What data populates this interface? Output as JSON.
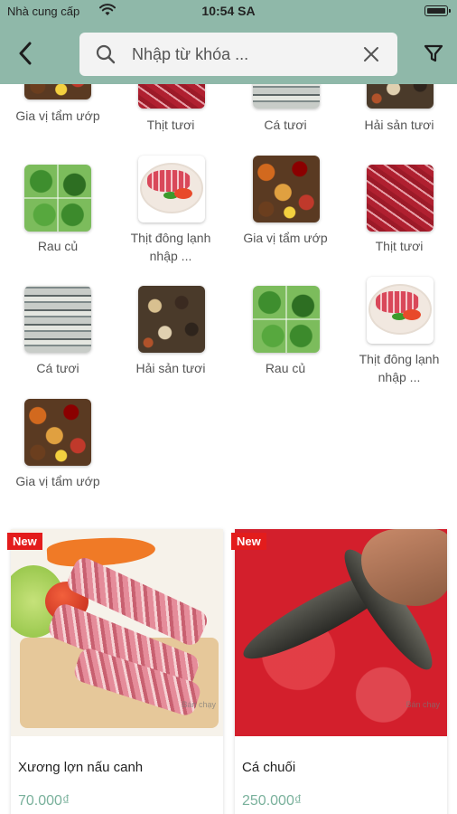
{
  "status_bar": {
    "carrier": "Nhà cung cấp",
    "time": "10:54 SA"
  },
  "search": {
    "placeholder": "Nhập từ khóa ..."
  },
  "colors": {
    "header": "#8fb8a9",
    "price": "#7ab19c",
    "badge": "#e31c1c"
  },
  "categories": [
    {
      "label": "Gia vị tẩm ướp",
      "thumb": "spice-thumbnail"
    },
    {
      "label": "Thịt tươi",
      "thumb": "meat-thumbnail"
    },
    {
      "label": "Cá tươi",
      "thumb": "fish-thumbnail"
    },
    {
      "label": "Hải sản tươi",
      "thumb": "seafood-thumbnail"
    },
    {
      "label": "Rau củ",
      "thumb": "vegetable-thumbnail"
    },
    {
      "label": "Thịt đông lạnh nhập ...",
      "thumb": "frozen-meat-thumbnail"
    },
    {
      "label": "Gia vị tẩm ướp",
      "thumb": "spice-thumbnail"
    },
    {
      "label": "Thịt tươi",
      "thumb": "meat-thumbnail"
    },
    {
      "label": "Cá tươi",
      "thumb": "fish-thumbnail"
    },
    {
      "label": "Hải sản tươi",
      "thumb": "seafood-thumbnail"
    },
    {
      "label": "Rau củ",
      "thumb": "vegetable-thumbnail"
    },
    {
      "label": "Thịt đông lạnh nhập ...",
      "thumb": "frozen-meat-thumbnail"
    },
    {
      "label": "Gia vị tẩm ướp",
      "thumb": "spice-thumbnail"
    }
  ],
  "products": [
    {
      "badge": "New",
      "name": "Xương lợn nấu canh",
      "price": "70.000₫",
      "watermark": "Bán chạy"
    },
    {
      "badge": "New",
      "name": "Cá chuối",
      "price": "250.000₫",
      "watermark": "Bán chạy"
    }
  ]
}
